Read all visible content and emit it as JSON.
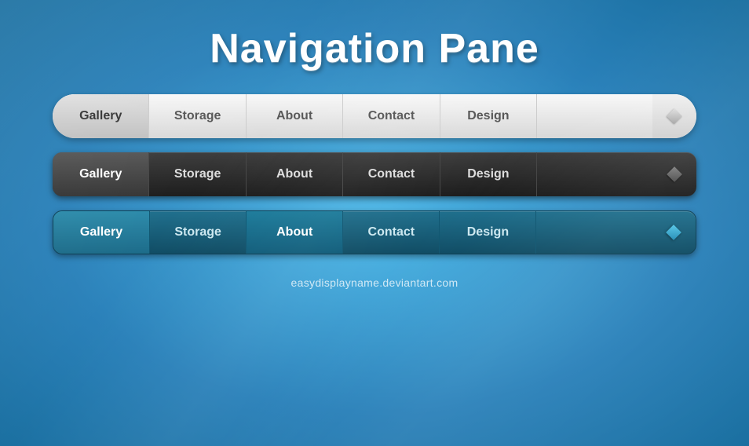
{
  "page": {
    "title": "Navigation Pane",
    "footer": "easydisplayname.deviantart.com"
  },
  "nav_white": {
    "items": [
      {
        "label": "Gallery",
        "active": true
      },
      {
        "label": "Storage",
        "active": false
      },
      {
        "label": "About",
        "active": false
      },
      {
        "label": "Contact",
        "active": false
      },
      {
        "label": "Design",
        "active": false
      }
    ],
    "diamond_label": "◇"
  },
  "nav_dark": {
    "items": [
      {
        "label": "Gallery",
        "active": true
      },
      {
        "label": "Storage",
        "active": false
      },
      {
        "label": "About",
        "active": false
      },
      {
        "label": "Contact",
        "active": false
      },
      {
        "label": "Design",
        "active": false
      }
    ]
  },
  "nav_blue": {
    "items": [
      {
        "label": "Gallery",
        "active": true
      },
      {
        "label": "Storage",
        "active": false
      },
      {
        "label": "About",
        "active": true
      },
      {
        "label": "Contact",
        "active": false
      },
      {
        "label": "Design",
        "active": false
      }
    ]
  }
}
